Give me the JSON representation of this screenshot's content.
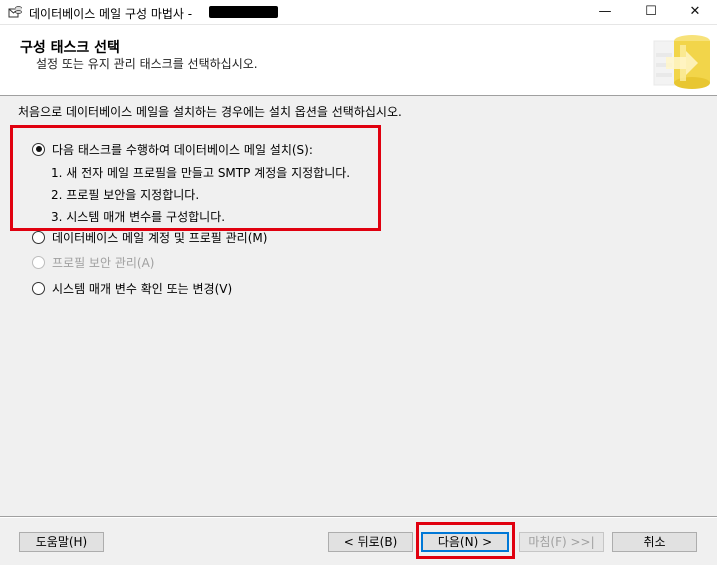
{
  "window": {
    "title": "데이터베이스 메일 구성 마법사 -",
    "minimize_glyph": "—",
    "maximize_glyph": "☐",
    "close_glyph": "✕",
    "icon": "db-mail-wizard-icon"
  },
  "header": {
    "title": "구성 태스크 선택",
    "subtitle": "설정 또는 유지 관리 태스크를 선택하십시오.",
    "art_icon": "database-wizard-art"
  },
  "main": {
    "instruction": "처음으로 데이터베이스 메일을 설치하는 경우에는 설치 옵션을 선택하십시오.",
    "options": [
      {
        "label": "다음 태스크를 수행하여 데이터베이스 메일 설치(S):",
        "checked": true,
        "enabled": true
      },
      {
        "label": "데이터베이스 메일 계정 및 프로필 관리(M)",
        "checked": false,
        "enabled": true
      },
      {
        "label": "프로필 보안 관리(A)",
        "checked": false,
        "enabled": false
      },
      {
        "label": "시스템 매개 변수 확인 또는 변경(V)",
        "checked": false,
        "enabled": true
      }
    ],
    "steps": [
      "1. 새 전자 메일 프로필을 만들고 SMTP 계정을 지정합니다.",
      "2. 프로필 보안을 지정합니다.",
      "3. 시스템 매개 변수를 구성합니다."
    ]
  },
  "footer": {
    "help_label": "도움말(H)",
    "back_label": "< 뒤로(B)",
    "next_label": "다음(N) >",
    "finish_label": "마침(F) >>|",
    "cancel_label": "취소"
  },
  "colors": {
    "highlight": "#e0000f",
    "default_button_border": "#0078d7"
  }
}
